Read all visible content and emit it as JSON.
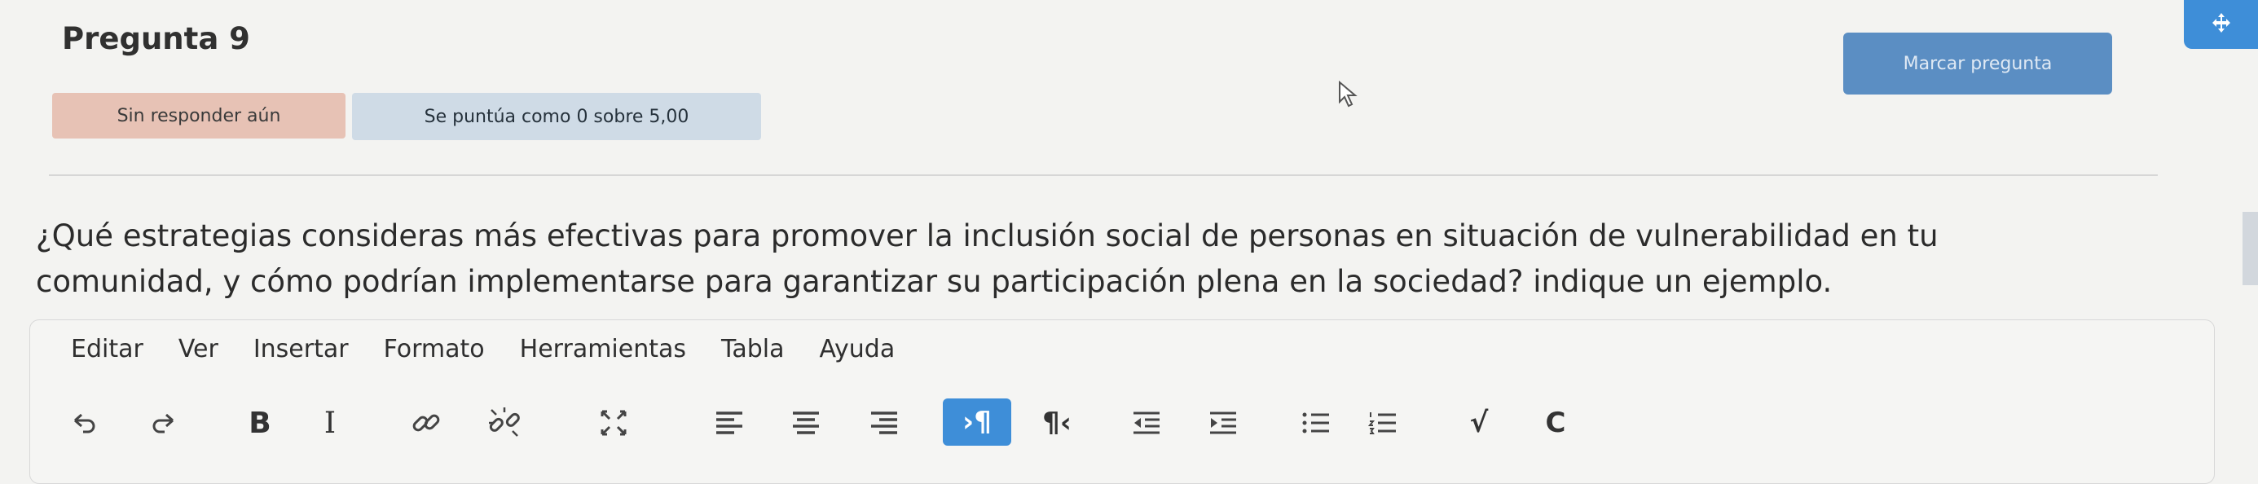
{
  "question_header": {
    "title": "Pregunta 9",
    "flag_label": "Marcar pregunta"
  },
  "status": {
    "state": "Sin responder aún",
    "score": "Se puntúa como 0 sobre 5,00"
  },
  "question": {
    "line1": "¿Qué estrategias consideras más efectivas para promover la inclusión social de personas en situación de vulnerabilidad en tu",
    "line2": "comunidad, y cómo podrían implementarse para garantizar su participación plena en la sociedad? indique un ejemplo."
  },
  "editor": {
    "menu": [
      "Editar",
      "Ver",
      "Insertar",
      "Formato",
      "Herramientas",
      "Tabla",
      "Ayuda"
    ],
    "toolbar": [
      {
        "icon": "undo-icon"
      },
      {
        "icon": "redo-icon"
      },
      {
        "icon": "bold-icon",
        "glyph": "B"
      },
      {
        "icon": "italic-icon",
        "glyph": "I"
      },
      {
        "icon": "link-icon"
      },
      {
        "icon": "unlink-icon"
      },
      {
        "icon": "fullscreen-icon"
      },
      {
        "icon": "align-left-icon"
      },
      {
        "icon": "align-center-icon"
      },
      {
        "icon": "align-right-icon"
      },
      {
        "icon": "ltr-icon",
        "glyph": "¶"
      },
      {
        "icon": "rtl-icon",
        "glyph": "¶"
      },
      {
        "icon": "outdent-icon"
      },
      {
        "icon": "indent-icon"
      },
      {
        "icon": "bullet-list-icon"
      },
      {
        "icon": "numbered-list-icon"
      },
      {
        "icon": "equation-icon",
        "glyph": "√"
      },
      {
        "icon": "chemistry-icon",
        "glyph": "C"
      }
    ]
  },
  "colors": {
    "accent": "#3e8ed8",
    "flag_button": "#5b8ec3",
    "status_badge": "#e7c2b5",
    "score_badge": "#cfdbe6"
  }
}
